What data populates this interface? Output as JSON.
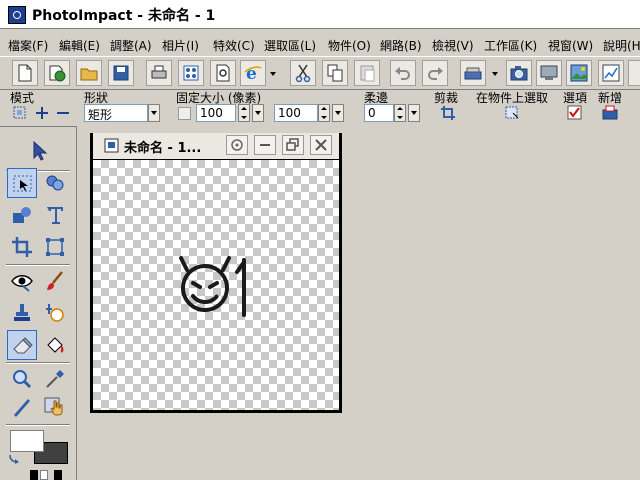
{
  "window": {
    "title": "PhotoImpact - 未命名 - 1"
  },
  "menu": [
    {
      "label": "檔案(F)"
    },
    {
      "label": "編輯(E)"
    },
    {
      "label": "調整(A)"
    },
    {
      "label": "相片(I)"
    },
    {
      "label": "特效(C)"
    },
    {
      "label": "選取區(L)"
    },
    {
      "label": "物件(O)"
    },
    {
      "label": "網路(B)"
    },
    {
      "label": "檢視(V)"
    },
    {
      "label": "工作區(K)"
    },
    {
      "label": "視窗(W)"
    },
    {
      "label": "說明(H)"
    }
  ],
  "toolbar_icons": [
    "new-icon",
    "open-web-icon",
    "open-folder-icon",
    "save-icon",
    "print-icon",
    "batch-icon",
    "preview-icon",
    "ie-browser-icon",
    "cut-icon",
    "copy-icon",
    "paste-icon",
    "undo-icon",
    "redo-icon",
    "scanner-icon",
    "camera-icon",
    "screen-capture-icon",
    "image-icon",
    "graph-icon"
  ],
  "options": {
    "mode_label": "模式",
    "shape_label": "形狀",
    "shape_value": "矩形",
    "fixed_size_label": "固定大小 (像素)",
    "width_value": "100",
    "height_value": "100",
    "soft_edge_label": "柔邊",
    "soft_edge_value": "0",
    "crop_label": "剪裁",
    "select_on_object_label": "在物件上選取",
    "options_label": "選項",
    "new_label": "新增"
  },
  "document": {
    "title": "未命名 - 1..."
  },
  "colors": {
    "foreground": "#ffffff",
    "background": "#404040",
    "accent": "#316ac5"
  }
}
